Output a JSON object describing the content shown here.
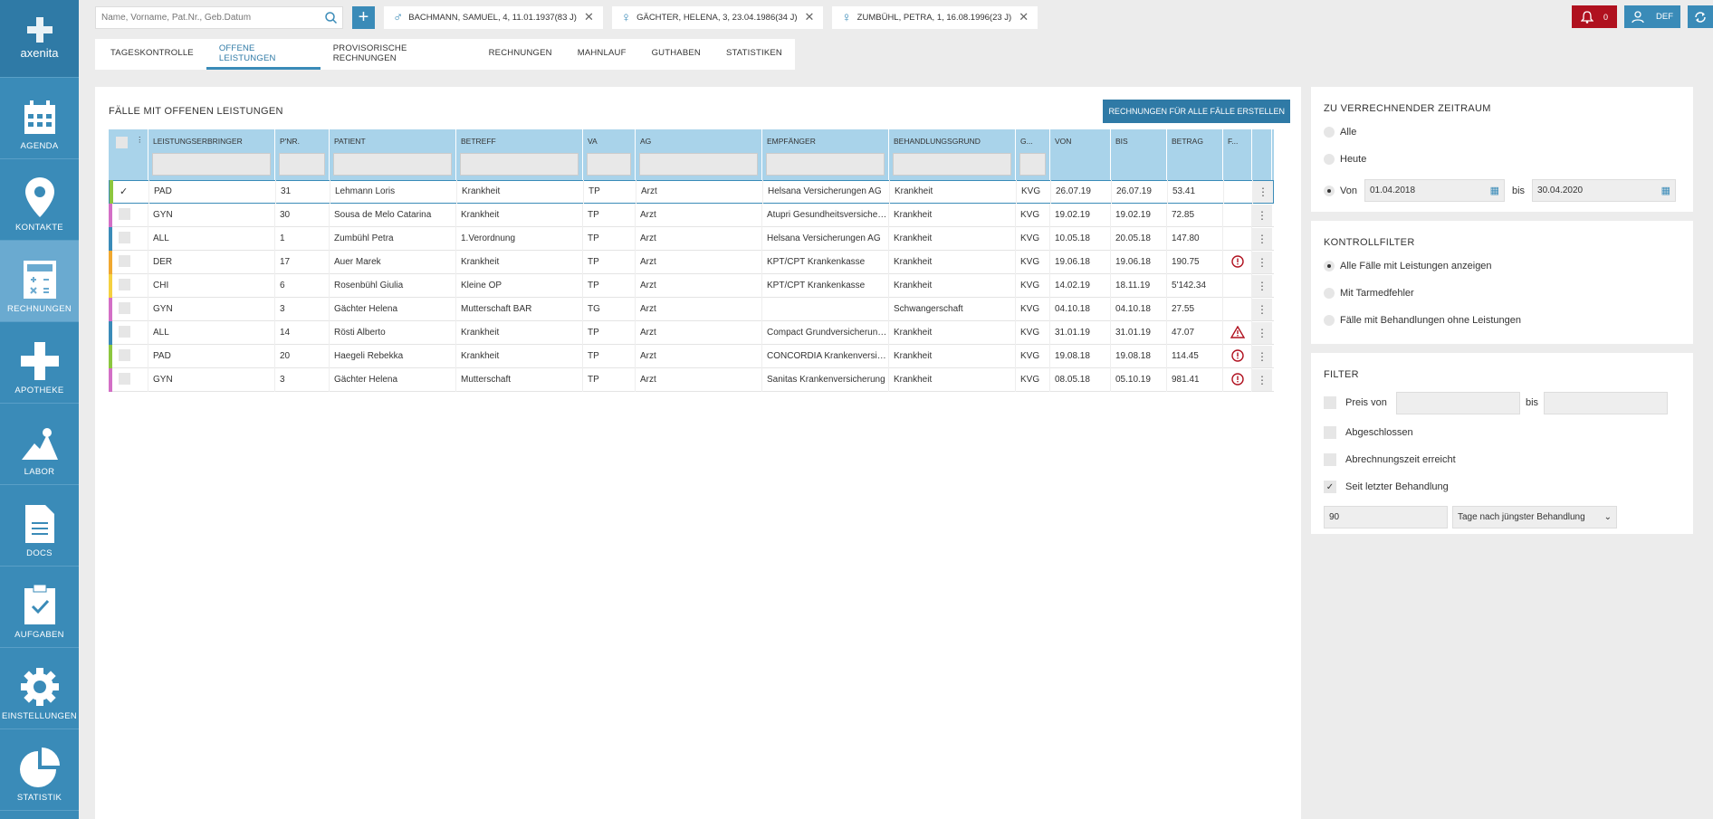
{
  "app": {
    "name": "axenita"
  },
  "nav": [
    {
      "label": "AGENDA",
      "icon": "calendar-icon"
    },
    {
      "label": "KONTAKTE",
      "icon": "location-pin-icon"
    },
    {
      "label": "RECHNUNGEN",
      "icon": "calculator-icon"
    },
    {
      "label": "APOTHEKE",
      "icon": "cross-icon"
    },
    {
      "label": "LABOR",
      "icon": "flask-icon"
    },
    {
      "label": "DOCS",
      "icon": "document-icon"
    },
    {
      "label": "AUFGABEN",
      "icon": "clipboard-check-icon"
    },
    {
      "label": "EINSTELLUNGEN",
      "icon": "gear-icon"
    },
    {
      "label": "STATISTIK",
      "icon": "pie-chart-icon"
    }
  ],
  "search": {
    "placeholder": "Name, Vorname, Pat.Nr., Geb.Datum"
  },
  "patient_tabs": [
    {
      "label": "BACHMANN, SAMUEL, 4, 11.01.1937(83 J)",
      "symbol": "♂"
    },
    {
      "label": "GÄCHTER, HELENA, 3, 23.04.1986(34 J)",
      "symbol": "♀"
    },
    {
      "label": "ZUMBÜHL, PETRA, 1, 16.08.1996(23 J)",
      "symbol": "♀"
    }
  ],
  "notifications": {
    "count": "0"
  },
  "user": {
    "initials": "DEF"
  },
  "tabs": [
    "TAGESKONTROLLE",
    "OFFENE LEISTUNGEN",
    "PROVISORISCHE RECHNUNGEN",
    "RECHNUNGEN",
    "MAHNLAUF",
    "GUTHABEN",
    "STATISTIKEN"
  ],
  "main": {
    "title": "FÄLLE MIT OFFENEN LEISTUNGEN",
    "create_button": "RECHNUNGEN FÜR ALLE FÄLLE ERSTELLEN"
  },
  "columns": [
    "LEISTUNGSERBRINGER",
    "P'NR.",
    "PATIENT",
    "BETREFF",
    "VA",
    "AG",
    "EMPFÄNGER",
    "BEHANDLUNGSGRUND",
    "G...",
    "VON",
    "BIS",
    "BETRAG",
    "F..."
  ],
  "rows": [
    {
      "color": "#8cc63f",
      "checked": true,
      "le": "PAD",
      "pnr": "31",
      "patient": "Lehmann Loris",
      "betreff": "Krankheit",
      "va": "TP",
      "ag": "Arzt",
      "empf": "Helsana Versicherungen AG",
      "grund": "Krankheit",
      "g": "KVG",
      "von": "26.07.19",
      "bis": "26.07.19",
      "betrag": "53.41",
      "f": ""
    },
    {
      "color": "#d36fc6",
      "checked": false,
      "le": "GYN",
      "pnr": "30",
      "patient": "Sousa de Melo Catarina",
      "betreff": "Krankheit",
      "va": "TP",
      "ag": "Arzt",
      "empf": "Atupri Gesundheitsversicherung",
      "grund": "Krankheit",
      "g": "KVG",
      "von": "19.02.19",
      "bis": "19.02.19",
      "betrag": "72.85",
      "f": ""
    },
    {
      "color": "#3a8bb8",
      "checked": false,
      "le": "ALL",
      "pnr": "1",
      "patient": "Zumbühl Petra",
      "betreff": "1.Verordnung",
      "va": "TP",
      "ag": "Arzt",
      "empf": "Helsana Versicherungen AG",
      "grund": "Krankheit",
      "g": "KVG",
      "von": "10.05.18",
      "bis": "20.05.18",
      "betrag": "147.80",
      "f": ""
    },
    {
      "color": "#f0a830",
      "checked": false,
      "le": "DER",
      "pnr": "17",
      "patient": "Auer Marek",
      "betreff": "Krankheit",
      "va": "TP",
      "ag": "Arzt",
      "empf": "KPT/CPT Krankenkasse",
      "grund": "Krankheit",
      "g": "KVG",
      "von": "19.06.18",
      "bis": "19.06.18",
      "betrag": "190.75",
      "f": "error"
    },
    {
      "color": "#f5d040",
      "checked": false,
      "le": "CHI",
      "pnr": "6",
      "patient": "Rosenbühl Giulia",
      "betreff": "Kleine OP",
      "va": "TP",
      "ag": "Arzt",
      "empf": "KPT/CPT Krankenkasse",
      "grund": "Krankheit",
      "g": "KVG",
      "von": "14.02.19",
      "bis": "18.11.19",
      "betrag": "5'142.34",
      "f": ""
    },
    {
      "color": "#d36fc6",
      "checked": false,
      "le": "GYN",
      "pnr": "3",
      "patient": "Gächter Helena",
      "betreff": "Mutterschaft BAR",
      "va": "TG",
      "ag": "Arzt",
      "empf": "",
      "grund": "Schwangerschaft",
      "g": "KVG",
      "von": "04.10.18",
      "bis": "04.10.18",
      "betrag": "27.55",
      "f": ""
    },
    {
      "color": "#3a8bb8",
      "checked": false,
      "le": "ALL",
      "pnr": "14",
      "patient": "Rösti Alberto",
      "betreff": "Krankheit",
      "va": "TP",
      "ag": "Arzt",
      "empf": "Compact Grundversicherungen",
      "grund": "Krankheit",
      "g": "KVG",
      "von": "31.01.19",
      "bis": "31.01.19",
      "betrag": "47.07",
      "f": "warning"
    },
    {
      "color": "#8cc63f",
      "checked": false,
      "le": "PAD",
      "pnr": "20",
      "patient": "Haegeli Rebekka",
      "betreff": "Krankheit",
      "va": "TP",
      "ag": "Arzt",
      "empf": "CONCORDIA Krankenversicherung",
      "grund": "Krankheit",
      "g": "KVG",
      "von": "19.08.18",
      "bis": "19.08.18",
      "betrag": "114.45",
      "f": "error"
    },
    {
      "color": "#d36fc6",
      "checked": false,
      "le": "GYN",
      "pnr": "3",
      "patient": "Gächter Helena",
      "betreff": "Mutterschaft",
      "va": "TP",
      "ag": "Arzt",
      "empf": "Sanitas Krankenversicherung",
      "grund": "Krankheit",
      "g": "KVG",
      "von": "08.05.18",
      "bis": "05.10.19",
      "betrag": "981.41",
      "f": "error"
    }
  ],
  "zeitraum": {
    "title": "ZU VERRECHNENDER ZEITRAUM",
    "opt_alle": "Alle",
    "opt_heute": "Heute",
    "opt_von": "Von",
    "von": "01.04.2018",
    "bis_label": "bis",
    "bis": "30.04.2020"
  },
  "kontrollfilter": {
    "title": "KONTROLLFILTER",
    "opt1": "Alle Fälle mit Leistungen anzeigen",
    "opt2": "Mit Tarmedfehler",
    "opt3": "Fälle mit Behandlungen ohne Leistungen"
  },
  "filter": {
    "title": "FILTER",
    "preis_von": "Preis von",
    "bis": "bis",
    "abgeschlossen": "Abgeschlossen",
    "abrechnungszeit": "Abrechnungszeit erreicht",
    "seit": "Seit letzter Behandlung",
    "tage_value": "90",
    "tage_option": "Tage nach jüngster Behandlung"
  }
}
